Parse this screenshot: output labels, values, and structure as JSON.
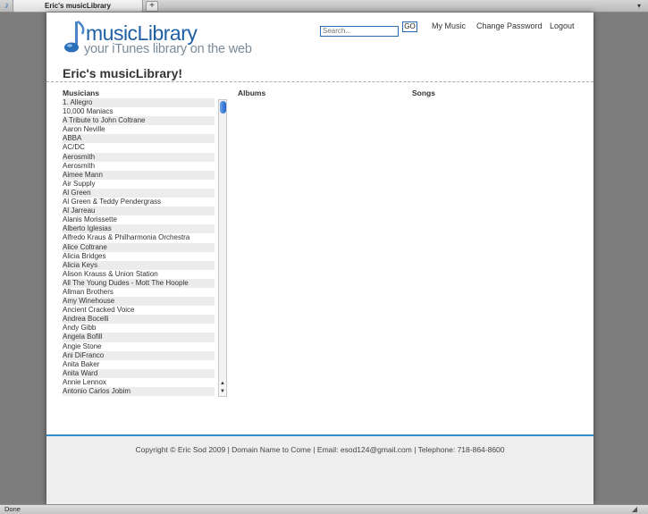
{
  "browser": {
    "tab_title": "Eric's musicLibrary",
    "new_tab_label": "+",
    "status_text": "Done"
  },
  "header": {
    "logo_main": "musicLibrary",
    "logo_sub": "your iTunes library on the web",
    "search_placeholder": "Search...",
    "go_label": "GO",
    "nav": {
      "my_music": "My Music",
      "change_password": "Change Password",
      "logout": "Logout"
    }
  },
  "main": {
    "title": "Eric's musicLibrary!",
    "columns": {
      "musicians": "Musicians",
      "albums": "Albums",
      "songs": "Songs"
    },
    "musicians": [
      "1. Allegro",
      "10,000 Maniacs",
      "A Tribute to John Coltrane",
      "Aaron Neville",
      "ABBA",
      "AC/DC",
      "Aerosmith",
      "Aerosmith",
      "Aimee Mann",
      "Air Supply",
      "Al Green",
      "Al Green & Teddy Pendergrass",
      "Al Jarreau",
      "Alanis Morissette",
      "Alberto Iglesias",
      "Alfredo Kraus & Philharmonia Orchestra",
      "Alice Coltrane",
      "Alicia Bridges",
      "Alicia Keys",
      "Alison Krauss & Union Station",
      "All The Young Dudes - Mott The Hoople",
      "Allman Brothers",
      "Amy Winehouse",
      "Ancient Cracked Voice",
      "Andrea Bocelli",
      "Andy Gibb",
      "Angela Bofill",
      "Angie Stone",
      "Ani DiFranco",
      "Anita Baker",
      "Anita Ward",
      "Annie Lennox",
      "Antonio Carlos Jobim"
    ]
  },
  "footer": {
    "text": "Copyright © Eric Sod 2009 | Domain Name to Come | Email: esod124@gmail.com | Telephone: 718-864-8600"
  },
  "colors": {
    "brand_blue": "#1f5fa3",
    "accent_blue": "#2e8fd0"
  }
}
